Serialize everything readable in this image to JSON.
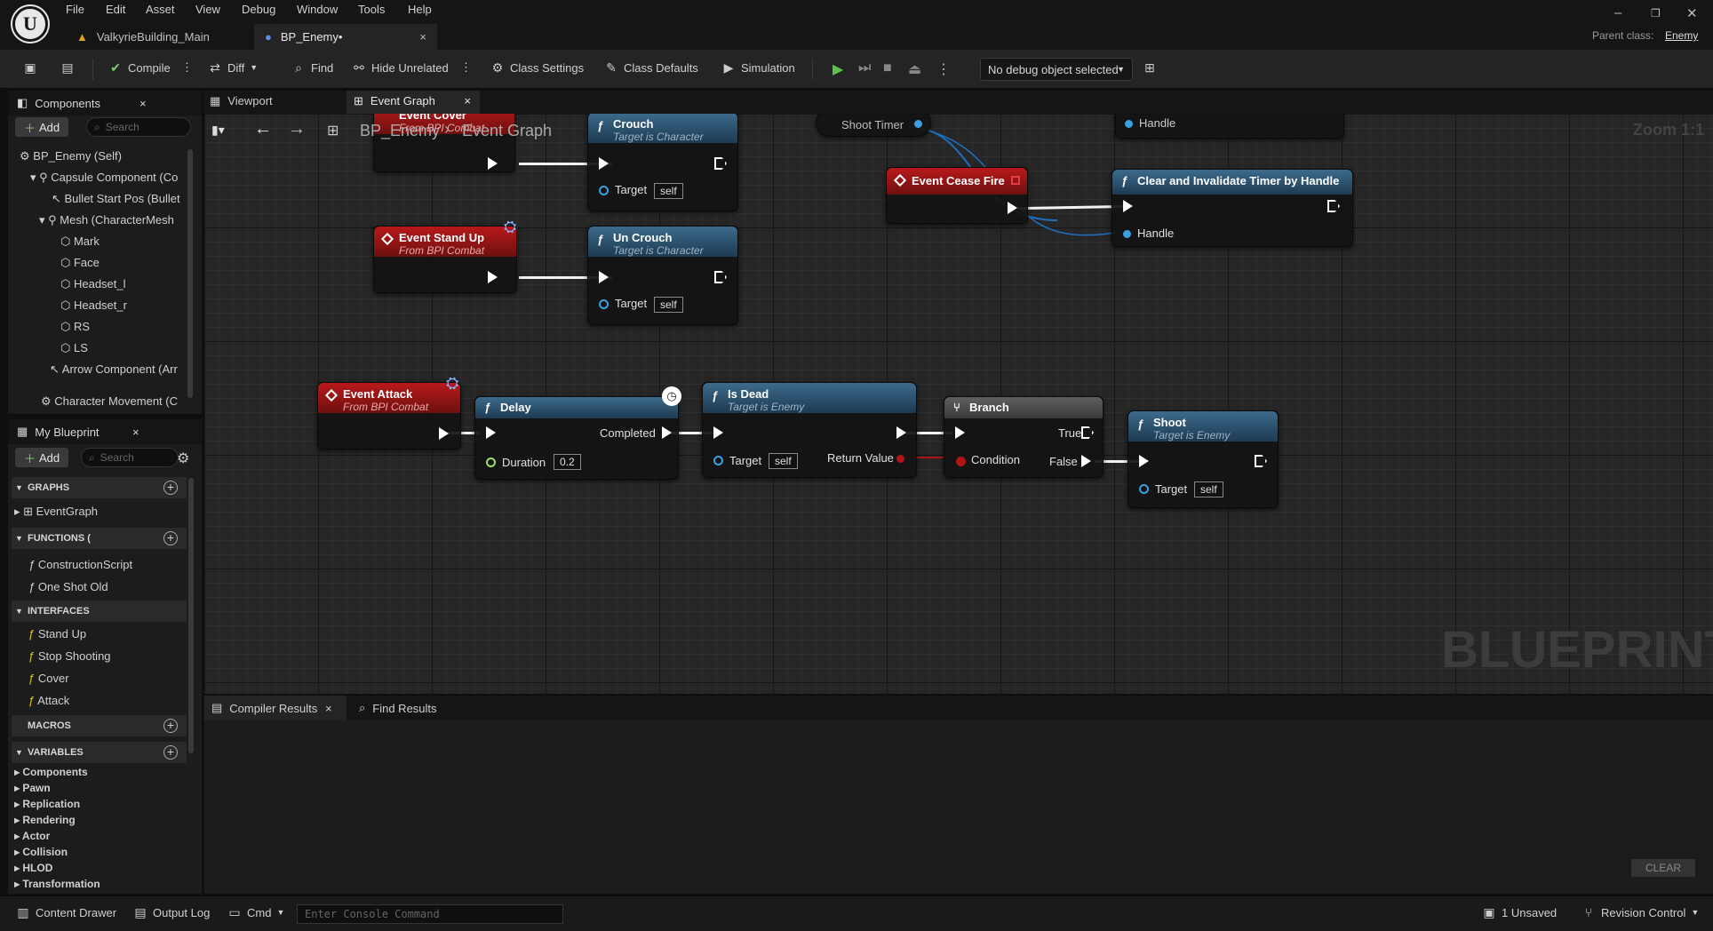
{
  "menu": [
    "File",
    "Edit",
    "Asset",
    "View",
    "Debug",
    "Window",
    "Tools",
    "Help"
  ],
  "doc_tabs": [
    {
      "label": "ValkyrieBuilding_Main"
    },
    {
      "label": "BP_Enemy•"
    }
  ],
  "parent_class": {
    "label": "Parent class:",
    "value": "Enemy"
  },
  "toolbar": {
    "compile": "Compile",
    "diff": "Diff",
    "find": "Find",
    "hide_unrelated": "Hide Unrelated",
    "class_settings": "Class Settings",
    "class_defaults": "Class Defaults",
    "simulation": "Simulation",
    "debug_object": "No debug object selected"
  },
  "components": {
    "tab": "Components",
    "add": "Add",
    "search_placeholder": "Search",
    "items": [
      "BP_Enemy (Self)",
      "Capsule Component (Co",
      "Bullet Start Pos (Bullet",
      "Mesh (CharacterMesh",
      "Mark",
      "Face",
      "Headset_l",
      "Headset_r",
      "RS",
      "LS",
      "Arrow Component (Arr",
      "Character Movement (C"
    ]
  },
  "my_blueprint": {
    "tab": "My Blueprint",
    "add": "Add",
    "search_placeholder": "Search",
    "graphs_header": "GRAPHS",
    "graphs": [
      "EventGraph"
    ],
    "functions_header": "FUNCTIONS (",
    "functions": [
      "ConstructionScript",
      "One Shot Old"
    ],
    "interfaces_header": "INTERFACES",
    "interfaces": [
      "Stand Up",
      "Stop Shooting",
      "Cover",
      "Attack"
    ],
    "macros_header": "MACROS",
    "variables_header": "VARIABLES",
    "variables": [
      "Components",
      "Pawn",
      "Replication",
      "Rendering",
      "Actor",
      "Collision",
      "HLOD",
      "Transformation"
    ]
  },
  "graph_tabs": {
    "viewport": "Viewport",
    "event_graph": "Event Graph"
  },
  "breadcrumb": {
    "bp": "BP_Enemy",
    "graph": "Event Graph",
    "zoom": "Zoom 1:1"
  },
  "watermark": "BLUEPRINT",
  "nodes": {
    "event_cover": {
      "title": "Event Cover",
      "sub": "From BPI Combat"
    },
    "crouch": {
      "title": "Crouch",
      "sub": "Target is Character",
      "target": "Target",
      "self": "self"
    },
    "shoot_timer": "Shoot Timer",
    "handle_top": "Handle",
    "event_cease_fire": {
      "title": "Event Cease Fire"
    },
    "clear_timer": {
      "title": "Clear and Invalidate Timer by Handle",
      "handle": "Handle"
    },
    "event_stand_up": {
      "title": "Event Stand Up",
      "sub": "From BPI Combat"
    },
    "uncrouch": {
      "title": "Un Crouch",
      "sub": "Target is Character",
      "target": "Target",
      "self": "self"
    },
    "event_attack": {
      "title": "Event Attack",
      "sub": "From BPI Combat"
    },
    "delay": {
      "title": "Delay",
      "completed": "Completed",
      "duration": "Duration",
      "duration_value": "0.2"
    },
    "is_dead": {
      "title": "Is Dead",
      "sub": "Target is Enemy",
      "target": "Target",
      "self": "self",
      "return": "Return Value"
    },
    "branch": {
      "title": "Branch",
      "true": "True",
      "false": "False",
      "condition": "Condition"
    },
    "shoot": {
      "title": "Shoot",
      "sub": "Target is Enemy",
      "target": "Target",
      "self": "self"
    }
  },
  "bottom_tabs": {
    "compiler": "Compiler Results",
    "find": "Find Results",
    "clear": "CLEAR"
  },
  "status": {
    "content_drawer": "Content Drawer",
    "output_log": "Output Log",
    "cmd": "Cmd",
    "console_placeholder": "Enter Console Command",
    "unsaved": "1 Unsaved",
    "revision": "Revision Control"
  }
}
